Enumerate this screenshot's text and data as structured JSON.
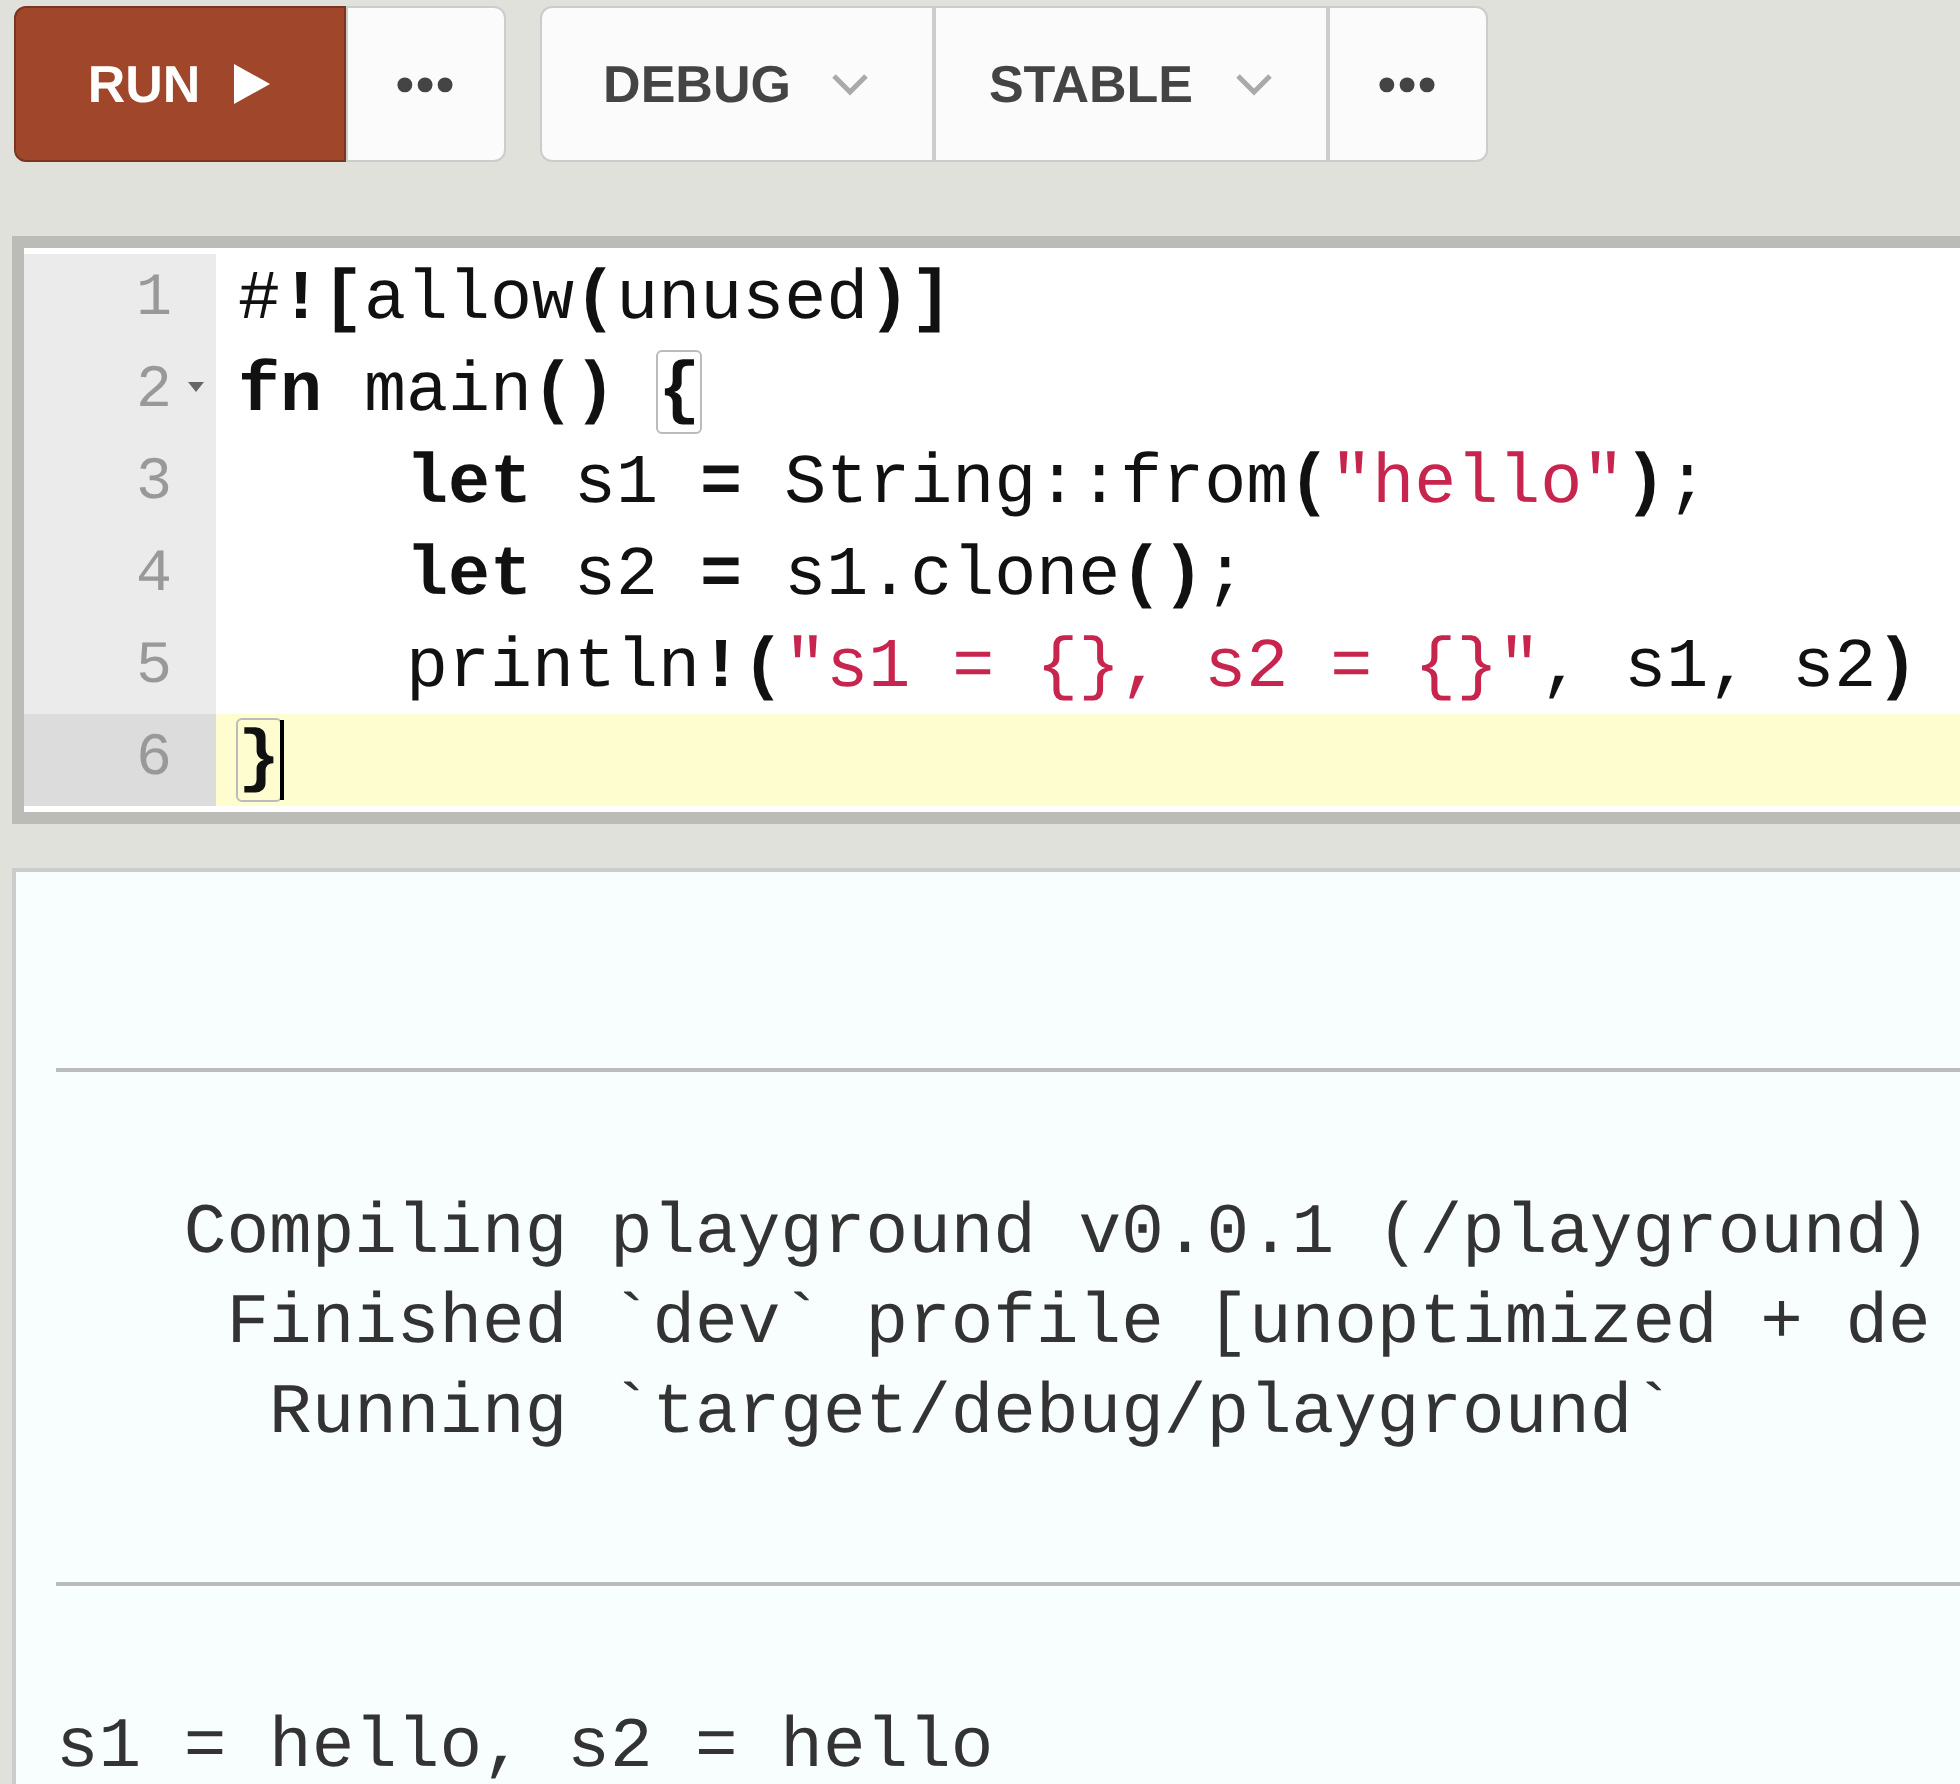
{
  "toolbar": {
    "groups": [
      {
        "items": [
          {
            "kind": "run",
            "label": "RUN"
          },
          {
            "kind": "more",
            "label": "•••"
          }
        ]
      },
      {
        "items": [
          {
            "kind": "menu",
            "label": "DEBUG"
          },
          {
            "kind": "menu",
            "label": "STABLE"
          },
          {
            "kind": "more",
            "label": "•••"
          }
        ]
      }
    ]
  },
  "editor": {
    "lines": [
      {
        "number": "1",
        "foldable": false,
        "active": false,
        "tokens": [
          {
            "kind": "plain",
            "text": "#"
          },
          {
            "kind": "bold",
            "text": "!["
          },
          {
            "kind": "plain",
            "text": "allow"
          },
          {
            "kind": "bold",
            "text": "("
          },
          {
            "kind": "plain",
            "text": "unused"
          },
          {
            "kind": "bold",
            "text": ")]"
          }
        ]
      },
      {
        "number": "2",
        "foldable": true,
        "active": false,
        "tokens": [
          {
            "kind": "bold",
            "text": "fn"
          },
          {
            "kind": "plain",
            "text": " main"
          },
          {
            "kind": "bold",
            "text": "() "
          },
          {
            "kind": "match",
            "text": "{"
          }
        ]
      },
      {
        "number": "3",
        "foldable": false,
        "active": false,
        "tokens": [
          {
            "kind": "bold",
            "text": "    let"
          },
          {
            "kind": "plain",
            "text": " s1 "
          },
          {
            "kind": "bold",
            "text": "="
          },
          {
            "kind": "plain",
            "text": " String::from"
          },
          {
            "kind": "bold",
            "text": "("
          },
          {
            "kind": "string",
            "text": "\"hello\""
          },
          {
            "kind": "bold",
            "text": ")"
          },
          {
            "kind": "plain",
            "text": ";"
          }
        ]
      },
      {
        "number": "4",
        "foldable": false,
        "active": false,
        "tokens": [
          {
            "kind": "bold",
            "text": "    let"
          },
          {
            "kind": "plain",
            "text": " s2 "
          },
          {
            "kind": "bold",
            "text": "="
          },
          {
            "kind": "plain",
            "text": " s1.clone"
          },
          {
            "kind": "bold",
            "text": "()"
          },
          {
            "kind": "plain",
            "text": ";"
          }
        ]
      },
      {
        "number": "5",
        "foldable": false,
        "active": false,
        "tokens": [
          {
            "kind": "plain",
            "text": "    println"
          },
          {
            "kind": "bold",
            "text": "!("
          },
          {
            "kind": "string",
            "text": "\"s1 = {}, s2 = {}\""
          },
          {
            "kind": "plain",
            "text": ", s1, s2"
          },
          {
            "kind": "bold",
            "text": ")"
          }
        ]
      },
      {
        "number": "6",
        "foldable": false,
        "active": true,
        "tokens": [
          {
            "kind": "match",
            "text": "}"
          }
        ]
      }
    ]
  },
  "output": {
    "sections": [
      {
        "lines": [
          "   Compiling playground v0.0.1 (/playground)",
          "    Finished `dev` profile [unoptimized + de",
          "     Running `target/debug/playground`"
        ]
      },
      {
        "lines": [
          "s1 = hello, s2 = hello"
        ]
      }
    ]
  }
}
